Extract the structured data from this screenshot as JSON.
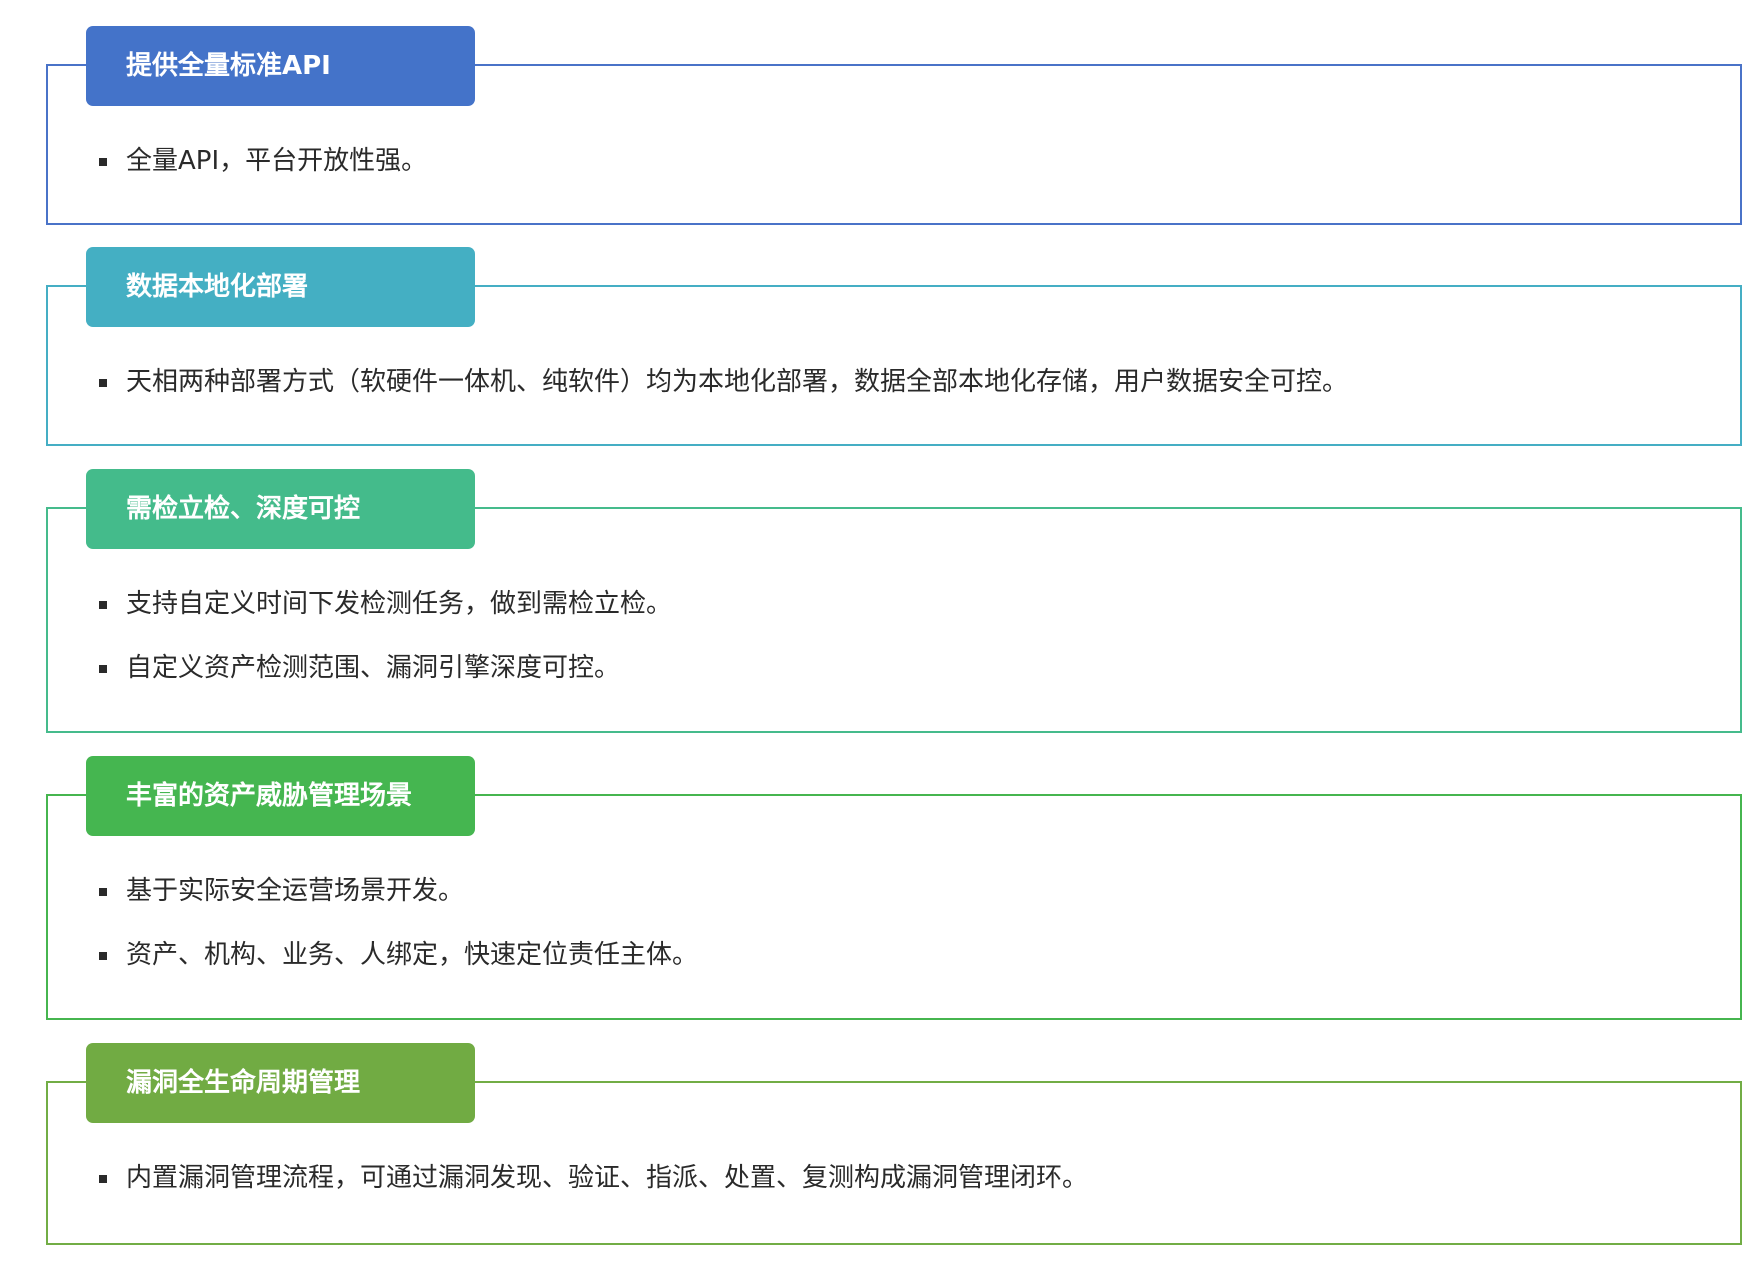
{
  "colors": {
    "section1": "#4473c9",
    "section2": "#44afc3",
    "section3": "#44bb8b",
    "section4": "#45b650",
    "section5": "#71ab43",
    "text": "#2a2a2a"
  },
  "sections": [
    {
      "title": "提供全量标准API",
      "items": [
        "全量API，平台开放性强。"
      ]
    },
    {
      "title": "数据本地化部署",
      "items": [
        "天相两种部署方式（软硬件一体机、纯软件）均为本地化部署，数据全部本地化存储，用户数据安全可控。"
      ]
    },
    {
      "title": "需检立检、深度可控",
      "items": [
        "支持自定义时间下发检测任务，做到需检立检。",
        "自定义资产检测范围、漏洞引擎深度可控。"
      ]
    },
    {
      "title": "丰富的资产威胁管理场景",
      "items": [
        "基于实际安全运营场景开发。",
        "资产、机构、业务、人绑定，快速定位责任主体。"
      ]
    },
    {
      "title": "漏洞全生命周期管理",
      "items": [
        "内置漏洞管理流程，可通过漏洞发现、验证、指派、处置、复测构成漏洞管理闭环。"
      ]
    }
  ]
}
